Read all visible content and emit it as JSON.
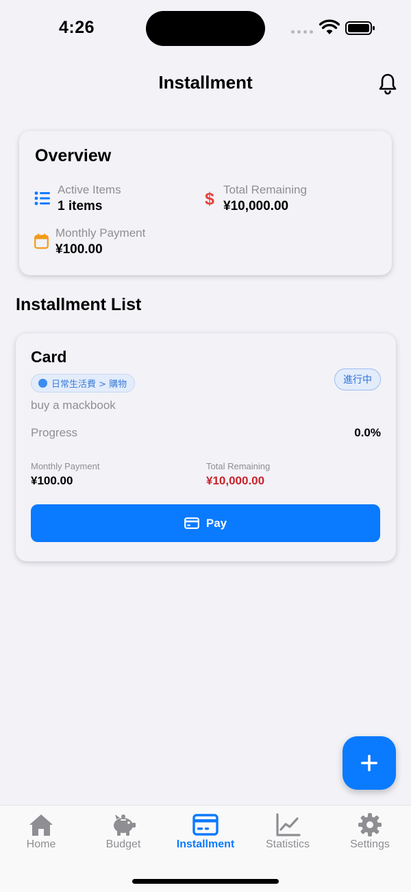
{
  "status_bar": {
    "time": "4:26"
  },
  "header": {
    "title": "Installment",
    "bell_icon": "bell-icon"
  },
  "overview": {
    "title": "Overview",
    "active_items": {
      "label": "Active Items",
      "value": "1 items",
      "icon": "list-icon",
      "color": "#0A7AFF"
    },
    "total_remaining": {
      "label": "Total Remaining",
      "value": "¥10,000.00",
      "icon": "dollar-icon",
      "color": "#E5413A"
    },
    "monthly_payment": {
      "label": "Monthly Payment",
      "value": "¥100.00",
      "icon": "calendar-icon",
      "color": "#F29A1A"
    }
  },
  "list": {
    "title": "Installment List",
    "items": [
      {
        "name": "Card",
        "category": "日常生活費 > 購物",
        "status": "進行中",
        "description": "buy a mackbook",
        "progress_label": "Progress",
        "progress_value": "0.0%",
        "monthly_payment_label": "Monthly Payment",
        "monthly_payment_value": "¥100.00",
        "total_remaining_label": "Total Remaining",
        "total_remaining_value": "¥10,000.00",
        "pay_label": "Pay"
      }
    ]
  },
  "tabs": [
    {
      "label": "Home",
      "icon": "house-icon",
      "active": false
    },
    {
      "label": "Budget",
      "icon": "piggy-bank-icon",
      "active": false
    },
    {
      "label": "Installment",
      "icon": "credit-card-icon",
      "active": true
    },
    {
      "label": "Statistics",
      "icon": "chart-line-icon",
      "active": false
    },
    {
      "label": "Settings",
      "icon": "gear-icon",
      "active": false
    }
  ],
  "colors": {
    "accent": "#0A7AFF",
    "background": "#F2F2F7",
    "negative": "#C8242B",
    "inactive": "#8E8E93"
  }
}
